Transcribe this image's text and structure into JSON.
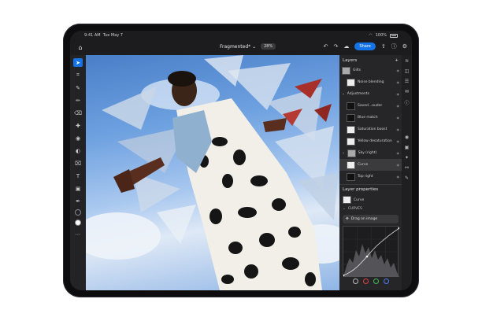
{
  "status": {
    "time": "9:41 AM",
    "date": "Tue May 7",
    "battery": "100%"
  },
  "header": {
    "document_title": "Fragmented",
    "document_modified": "*",
    "zoom": "28%",
    "share_label": "Share",
    "icons": [
      "home-icon",
      "undo-icon",
      "redo-icon",
      "cloud-icon",
      "share-icon",
      "help-icon",
      "settings-icon"
    ]
  },
  "tools": [
    "select-icon",
    "lasso-icon",
    "quick-select-icon",
    "brush-icon",
    "eraser-icon",
    "healing-icon",
    "clone-icon",
    "adjust-icon",
    "crop-icon",
    "type-icon",
    "fill-icon",
    "eyedropper-icon",
    "more-icon"
  ],
  "layers_panel": {
    "title": "Layers",
    "items": [
      {
        "name": "Gilts",
        "indent": 0,
        "thumb": "image",
        "selected": false
      },
      {
        "name": "Noise blending",
        "indent": 1,
        "thumb": "white",
        "selected": false
      },
      {
        "name": "Adjustments",
        "indent": 0,
        "thumb": "none",
        "selected": false,
        "group": true
      },
      {
        "name": "Saved...ouder",
        "indent": 1,
        "thumb": "dark",
        "selected": false
      },
      {
        "name": "Blue match",
        "indent": 1,
        "thumb": "dark",
        "selected": false
      },
      {
        "name": "Saturation boost",
        "indent": 1,
        "thumb": "white",
        "selected": false
      },
      {
        "name": "Yellow desaturation",
        "indent": 1,
        "thumb": "white",
        "selected": false
      },
      {
        "name": "Sky (right)",
        "indent": 0,
        "thumb": "image",
        "selected": false,
        "group": true
      },
      {
        "name": "Curve",
        "indent": 1,
        "thumb": "white",
        "selected": true
      },
      {
        "name": "Top right",
        "indent": 1,
        "thumb": "dark",
        "selected": false
      }
    ]
  },
  "properties": {
    "title": "Layer properties",
    "layer_name": "Curve",
    "section": "CURVES",
    "drag_label": "Drag on image",
    "channels": [
      {
        "name": "rgb",
        "color": "#bbbbbb"
      },
      {
        "name": "red",
        "color": "#e04040"
      },
      {
        "name": "green",
        "color": "#3fbf4f"
      },
      {
        "name": "blue",
        "color": "#4a7ff0"
      }
    ]
  },
  "colors": {
    "accent": "#1473e6",
    "panel": "#262628"
  }
}
